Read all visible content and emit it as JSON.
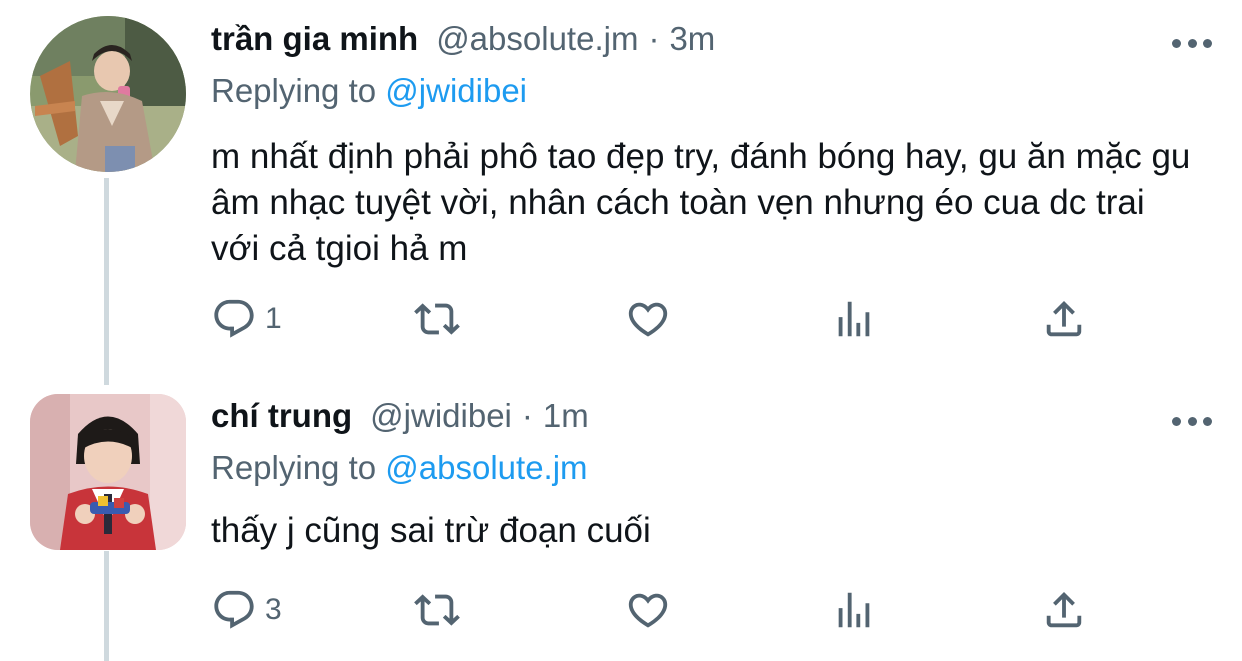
{
  "tweets": [
    {
      "name": "trần gia minh",
      "handle": "@absolute.jm",
      "separator": "·",
      "time": "3m",
      "replying_prefix": "Replying to",
      "replying_to": "@jwidibei",
      "text": "m nhất định phải phô tao đẹp try, đánh bóng hay, gu ăn mặc gu âm nhạc tuyệt vời, nhân cách toàn vẹn nhưng éo cua dc trai với cả tgioi hả m",
      "reply_count": "1",
      "retweet_count": "",
      "like_count": ""
    },
    {
      "name": "chí trung",
      "handle": "@jwidibei",
      "separator": "·",
      "time": "1m",
      "replying_prefix": "Replying to",
      "replying_to": "@absolute.jm",
      "text": "thấy j cũng sai trừ đoạn cuối",
      "reply_count": "3",
      "retweet_count": "",
      "like_count": ""
    }
  ],
  "icons": {
    "reply": "reply-icon",
    "retweet": "retweet-icon",
    "like": "like-icon",
    "stats": "stats-icon",
    "share": "share-icon",
    "more": "more-icon"
  },
  "colors": {
    "text": "#0f1419",
    "secondary": "#536471",
    "accent": "#1d9bf0",
    "thread_line": "#cfd9de"
  }
}
